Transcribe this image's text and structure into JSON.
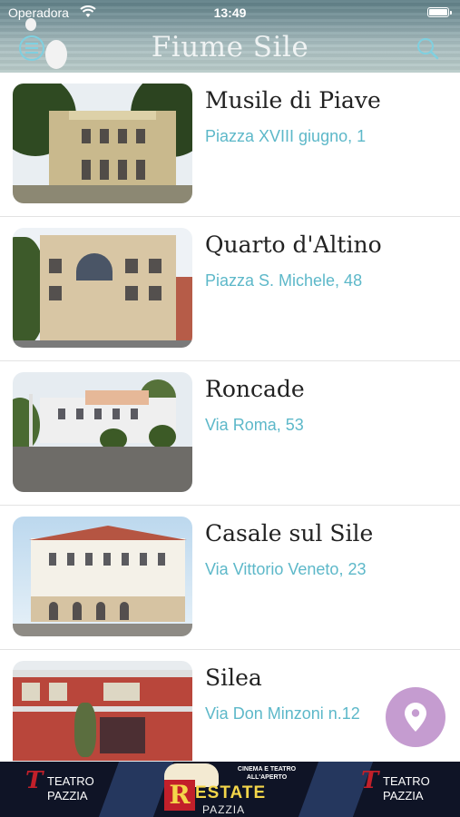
{
  "status_bar": {
    "carrier": "Operadora",
    "time": "13:49"
  },
  "header": {
    "title": "Fiume Sile"
  },
  "places": [
    {
      "name": "Musile di Piave",
      "address": "Piazza XVIII giugno, 1"
    },
    {
      "name": "Quarto d'Altino",
      "address": "Piazza S. Michele, 48"
    },
    {
      "name": "Roncade",
      "address": "Via Roma, 53"
    },
    {
      "name": "Casale sul Sile",
      "address": "Via Vittorio Veneto, 23"
    },
    {
      "name": "Silea",
      "address": " Via Don Minzoni n.12"
    }
  ],
  "banner": {
    "left_logo_teatro": "TEATRO",
    "left_logo_pazzia": "PAZZIA",
    "center_cinema": "CINEMA E TEATRO ALL'APERTO",
    "center_estate": "ESTATE",
    "center_pazzia": "PAZZIA",
    "right_logo_teatro": "TEATRO",
    "right_logo_pazzia": "PAZZIA"
  },
  "colors": {
    "accent": "#5db8c9",
    "fab": "#c59cd0",
    "title_text": "#222222"
  },
  "icons": {
    "menu": "menu-icon",
    "search": "search-icon",
    "map": "map-pin-icon",
    "wifi": "wifi-icon",
    "battery": "battery-icon"
  }
}
